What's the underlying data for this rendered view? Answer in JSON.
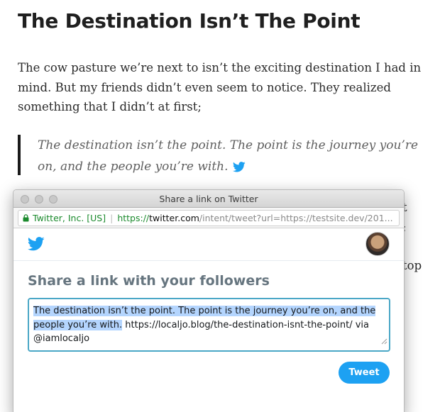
{
  "article": {
    "title": "The Destination Isn’t The Point",
    "paragraph": "The cow pasture we’re next to isn’t the exciting destination I had in mind. But my friends didn’t even seem to notice. They realized something that I didn’t at first;",
    "quote": "The destination isn’t the point. The point is the journey you’re on, and the people you’re with.",
    "behind_fragments": [
      "t",
      ";",
      "top"
    ]
  },
  "popup": {
    "window_title": "Share a link on Twitter",
    "url": {
      "org": "Twitter, Inc. [US]",
      "scheme": "https://",
      "host": "twitter.com",
      "path": "/intent/tweet?url=https://testsite.dev/201..."
    },
    "heading": "Share a link with your followers",
    "tweet": {
      "selected_text": "The destination isn’t the point. The point is the journey you’re on, and the people you’re with.",
      "rest_text": " https://localjo.blog/the-destination-isnt-the-point/ via @iamlocaljo"
    },
    "tweet_button": "Tweet"
  },
  "colors": {
    "twitter_blue": "#1da1f2",
    "heading_gray": "#66757f",
    "secure_green": "#1b8a2d",
    "selection": "#b4d5fe"
  },
  "icons": [
    "twitter-bird-icon",
    "lock-icon",
    "avatar",
    "resize-grip-icon"
  ]
}
